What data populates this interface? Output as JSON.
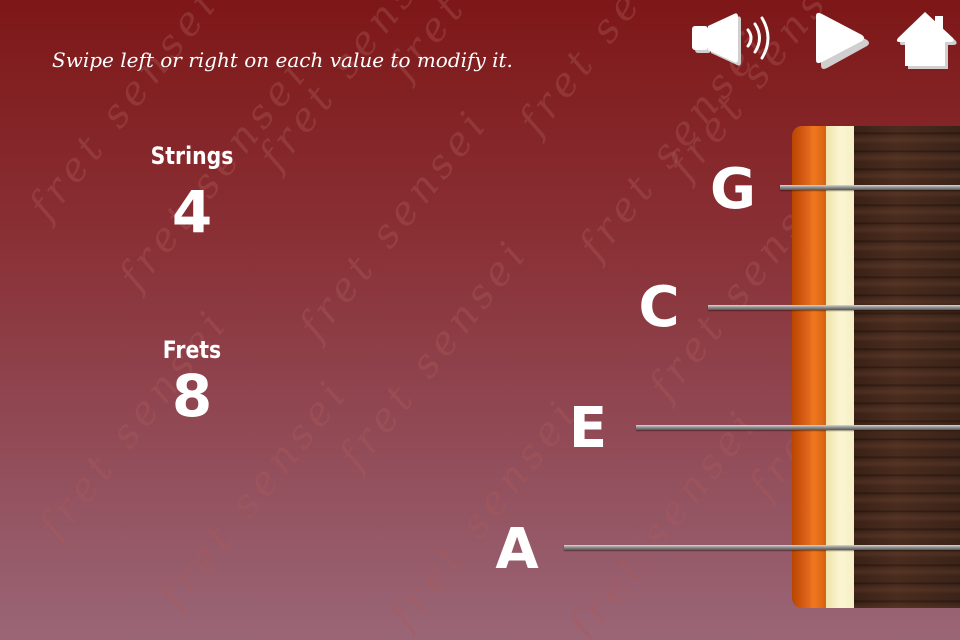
{
  "instructions": "Swipe left or right on each value to modify it.",
  "watermark_text": "fret sensei",
  "settings": {
    "strings": {
      "label": "Strings",
      "value": "4"
    },
    "frets": {
      "label": "Frets",
      "value": "8"
    }
  },
  "toolbar": {
    "icons": [
      "speaker-icon",
      "play-icon",
      "home-icon"
    ]
  },
  "tuning": {
    "strings": [
      {
        "note": "G"
      },
      {
        "note": "C"
      },
      {
        "note": "E"
      },
      {
        "note": "A"
      }
    ]
  },
  "colors": {
    "background_top": "#7e1717",
    "background_bottom": "#9a6677",
    "text": "#ffffff",
    "headstock": "#e0661a",
    "nut": "#fbf5d3",
    "fretboard_wood": "#4a2c1e"
  }
}
